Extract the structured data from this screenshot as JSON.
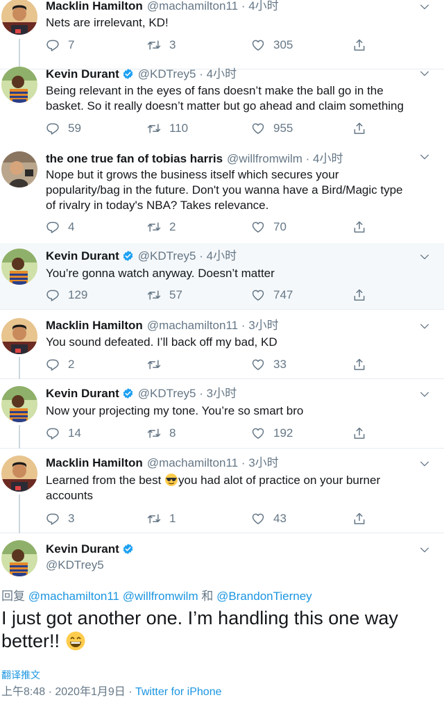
{
  "tweets": [
    {
      "name": "Macklin Hamilton",
      "handle": "@machamilton11",
      "time": "4小时",
      "lines": [
        "Nets are irrelevant, KD!"
      ],
      "replies": "7",
      "retweets": "3",
      "likes": "305"
    },
    {
      "name": "Kevin Durant",
      "handle": "@KDTrey5",
      "time": "4小时",
      "lines": [
        "Being relevant in the eyes of fans doesn’t make the ball go in the",
        "basket. So it really doesn’t matter but go ahead and claim something"
      ],
      "replies": "59",
      "retweets": "110",
      "likes": "955"
    },
    {
      "name": "the one true fan of tobias harris",
      "handle": "@willfromwilm",
      "time": "4小时",
      "lines": [
        "Nope but it grows the business itself which secures your",
        "popularity/bag in the future. Don't you wanna have a Bird/Magic type",
        "of rivalry in today's NBA? Takes relevance."
      ],
      "replies": "4",
      "retweets": "2",
      "likes": "70"
    },
    {
      "name": "Kevin Durant",
      "handle": "@KDTrey5",
      "time": "4小时",
      "lines": [
        "You’re gonna watch anyway. Doesn’t matter"
      ],
      "replies": "129",
      "retweets": "57",
      "likes": "747"
    },
    {
      "name": "Macklin Hamilton",
      "handle": "@machamilton11",
      "time": "3小时",
      "lines": [
        "You sound defeated. I’ll back off my bad, KD"
      ],
      "replies": "2",
      "retweets": "",
      "likes": "33"
    },
    {
      "name": "Kevin Durant",
      "handle": "@KDTrey5",
      "time": "3小时",
      "lines": [
        "Now your projecting my tone. You’re so smart bro"
      ],
      "replies": "14",
      "retweets": "8",
      "likes": "192"
    },
    {
      "name": "Macklin Hamilton",
      "handle": "@machamilton11",
      "time": "3小时",
      "lines_a": "Learned from the best ",
      "lines_b": "you had alot of practice on your burner",
      "line2": "accounts",
      "replies": "3",
      "retweets": "1",
      "likes": "43"
    }
  ],
  "main": {
    "name": "Kevin Durant",
    "handle": "@KDTrey5",
    "replying_prefix": "回复",
    "replying_to_1": "@machamilton11",
    "replying_to_2": "@willfromwilm",
    "replying_and": "和",
    "replying_to_3": "@BrandonTierney",
    "text_line1": "I just got another one. I’m handling this one way",
    "text_line2": "better!!",
    "translate": "翻译推文",
    "timestamp": "上午8:48 · 2020年1月9日 ·",
    "source": "Twitter for iPhone"
  },
  "colors": {
    "link": "#1b95e0",
    "verified": "#1da1f2",
    "muted": "#657786",
    "highlight_bg": "#f5f8fa"
  },
  "icons": [
    "reply-icon",
    "retweet-icon",
    "like-icon",
    "share-icon",
    "verified-icon",
    "caret-down-icon",
    "sunglasses-emoji",
    "grin-emoji"
  ]
}
